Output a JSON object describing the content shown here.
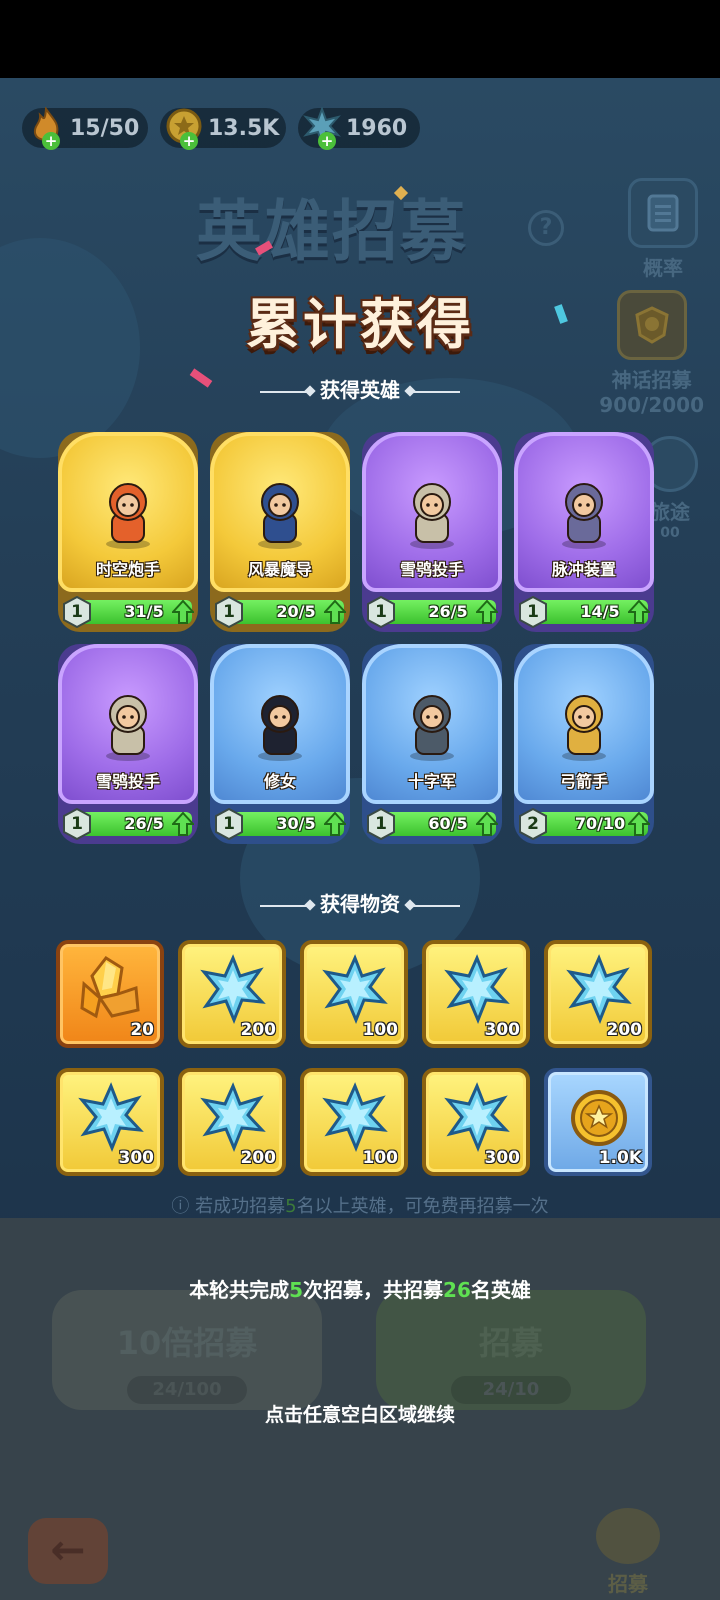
{
  "currencies": {
    "energy": "15/50",
    "gold": "13.5K",
    "crystal": "1960"
  },
  "background": {
    "title": "英雄招募",
    "help": "?",
    "side_buttons": {
      "probability": "概率",
      "mythic": "神话招募",
      "mythic_progress": "900/2000",
      "journey": "旅途",
      "journey_count": "00"
    },
    "hint_prefix": "ⓘ 若成功招募",
    "hint_num": "5",
    "hint_suffix": "名以上英雄，可免费再招募一次",
    "ten_recruit": "10倍招募",
    "ten_cost": "24/100",
    "recruit": "招募",
    "recruit_cost": "24/10",
    "recruit_side": "招募"
  },
  "title": "累计获得",
  "heroes_section": "获得英雄",
  "items_section": "获得物资",
  "heroes": [
    {
      "name": "时空炮手",
      "level": "1",
      "progress": "31/5",
      "fill": 1.0,
      "rarity": "gold"
    },
    {
      "name": "风暴魔导",
      "level": "1",
      "progress": "20/5",
      "fill": 1.0,
      "rarity": "gold"
    },
    {
      "name": "雪鸮投手",
      "level": "1",
      "progress": "26/5",
      "fill": 1.0,
      "rarity": "purple"
    },
    {
      "name": "脉冲装置",
      "level": "1",
      "progress": "14/5",
      "fill": 1.0,
      "rarity": "purple"
    },
    {
      "name": "雪鸮投手",
      "level": "1",
      "progress": "26/5",
      "fill": 1.0,
      "rarity": "purple"
    },
    {
      "name": "修女",
      "level": "1",
      "progress": "30/5",
      "fill": 1.0,
      "rarity": "blue"
    },
    {
      "name": "十字军",
      "level": "1",
      "progress": "60/5",
      "fill": 1.0,
      "rarity": "blue"
    },
    {
      "name": "弓箭手",
      "level": "2",
      "progress": "70/10",
      "fill": 1.0,
      "rarity": "blue"
    }
  ],
  "items": [
    {
      "icon": "amber-crystal-icon",
      "qty": "20",
      "frame": "orange"
    },
    {
      "icon": "blue-crystal-icon",
      "qty": "200",
      "frame": "gold"
    },
    {
      "icon": "blue-crystal-icon",
      "qty": "100",
      "frame": "gold"
    },
    {
      "icon": "blue-crystal-icon",
      "qty": "300",
      "frame": "gold"
    },
    {
      "icon": "blue-crystal-icon",
      "qty": "200",
      "frame": "gold"
    },
    {
      "icon": "blue-crystal-icon",
      "qty": "300",
      "frame": "gold"
    },
    {
      "icon": "blue-crystal-icon",
      "qty": "200",
      "frame": "gold"
    },
    {
      "icon": "blue-crystal-icon",
      "qty": "100",
      "frame": "gold"
    },
    {
      "icon": "blue-crystal-icon",
      "qty": "300",
      "frame": "gold"
    },
    {
      "icon": "gold-coin-icon",
      "qty": "1.0K",
      "frame": "blue"
    }
  ],
  "summary": {
    "part1": "本轮共完成",
    "times": "5",
    "part2": "次招募，共招募",
    "count": "26",
    "part3": "名英雄"
  },
  "continue_text": "点击任意空白区域继续"
}
